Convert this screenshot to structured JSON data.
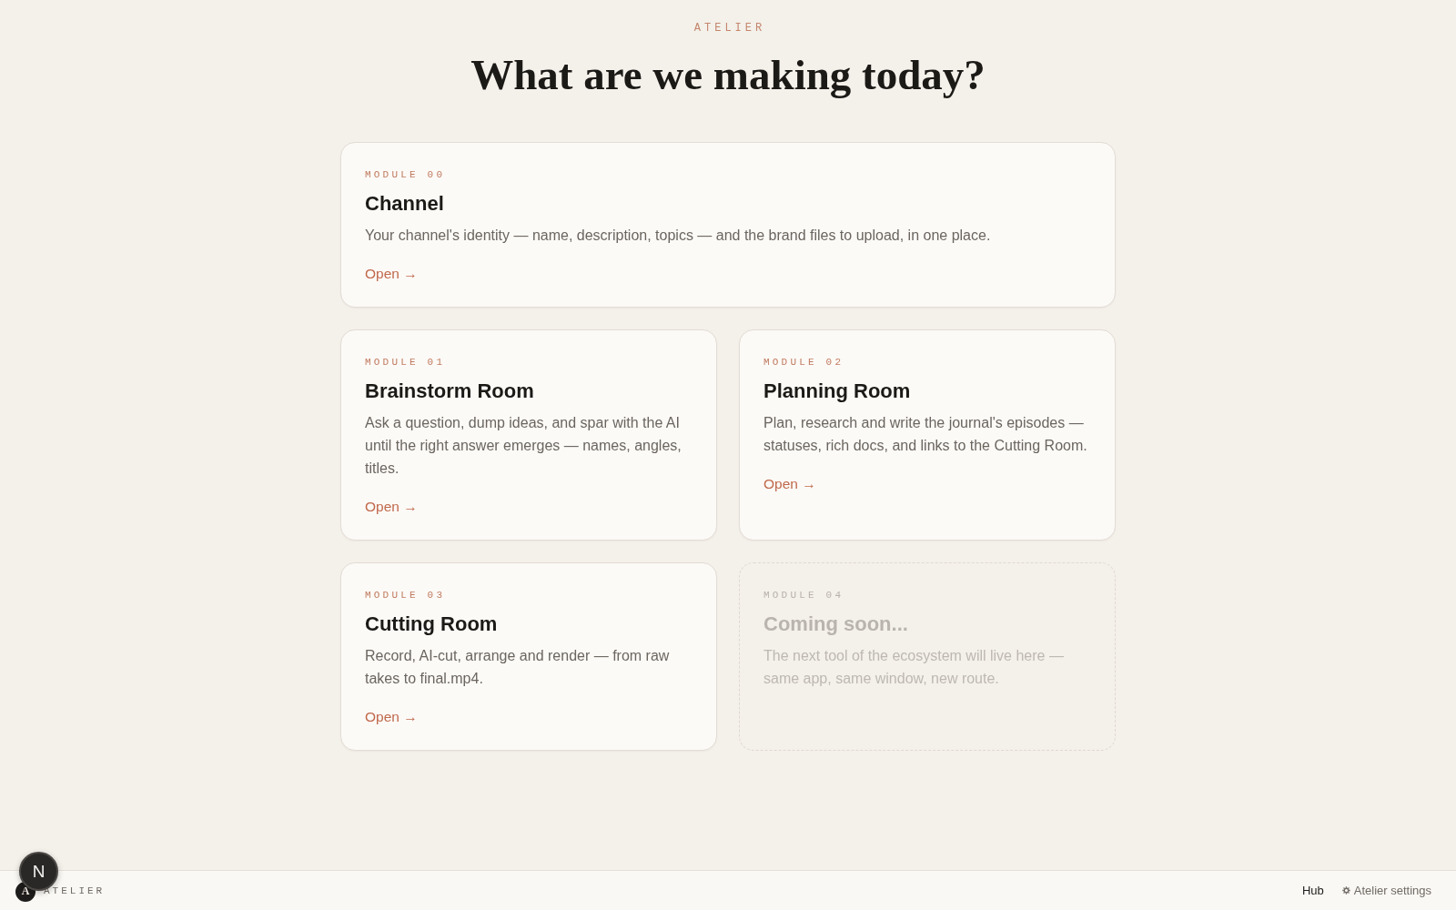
{
  "header": {
    "eyebrow": "ATELIER",
    "title": "What are we making today?"
  },
  "modules": [
    {
      "label": "MODULE 00",
      "title": "Channel",
      "description": "Your channel's identity — name, description, topics — and the brand files to upload, in one place.",
      "link": "Open →",
      "wide": true,
      "disabled": false
    },
    {
      "label": "MODULE 01",
      "title": "Brainstorm Room",
      "description": "Ask a question, dump ideas, and spar with the AI until the right answer emerges — names, angles, titles.",
      "link": "Open →",
      "wide": false,
      "disabled": false
    },
    {
      "label": "MODULE 02",
      "title": "Planning Room",
      "description": "Plan, research and write the journal's episodes — statuses, rich docs, and links to the Cutting Room.",
      "link": "Open →",
      "wide": false,
      "disabled": false
    },
    {
      "label": "MODULE 03",
      "title": "Cutting Room",
      "description": "Record, AI-cut, arrange and render — from raw takes to final.mp4.",
      "link": "Open →",
      "wide": false,
      "disabled": false
    },
    {
      "label": "MODULE 04",
      "title": "Coming soon...",
      "description": "The next tool of the ecosystem will live here — same app, same window, new route.",
      "wide": false,
      "disabled": true
    }
  ],
  "footer": {
    "logo_letter": "A",
    "brand": "ATELIER",
    "nav": [
      {
        "kind": "link",
        "label": "Hub",
        "selected": true
      },
      {
        "kind": "settings",
        "label": "Atelier settings",
        "selected": false
      }
    ]
  },
  "dev_indicator": {
    "label": "N"
  }
}
